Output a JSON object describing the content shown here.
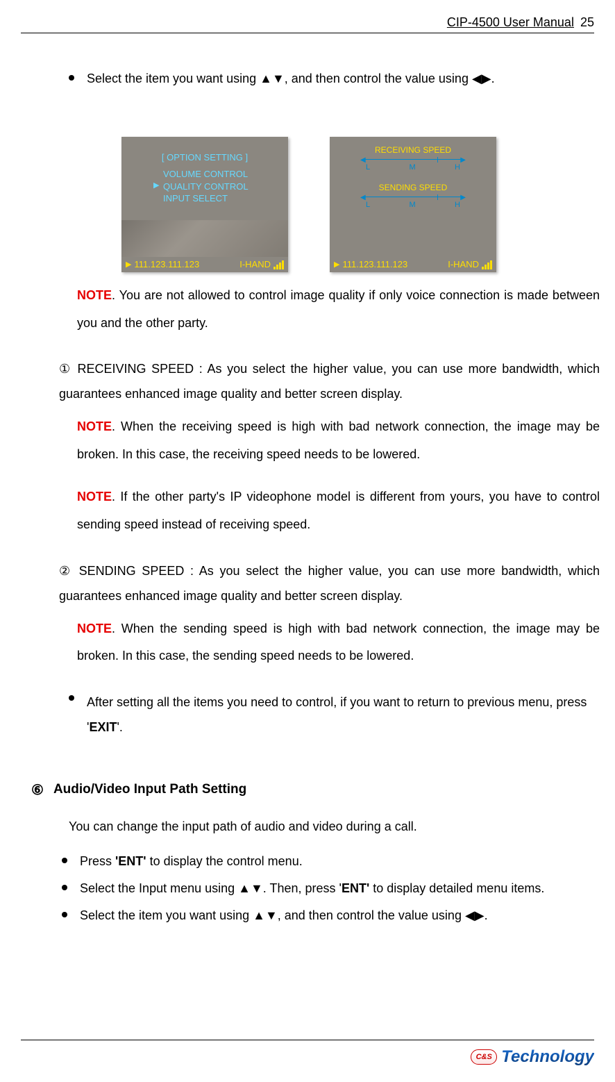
{
  "header": {
    "title": "CIP-4500 User Manual",
    "page": "25"
  },
  "bullets": {
    "top": "Select the item you want using ▲▼, and then control the value using ◀▶."
  },
  "shot1": {
    "title": "[  OPTION SETTING  ]",
    "items": [
      "VOLUME CONTROL",
      "QUALITY CONTROL",
      "INPUT SELECT"
    ],
    "status_ip": "111.123.111.123",
    "status_mode": "I-HAND"
  },
  "shot2": {
    "recv_label": "RECEIVING SPEED",
    "send_label": "SENDING SPEED",
    "ticks": {
      "l": "L",
      "m": "M",
      "h": "H"
    },
    "status_ip": "111.123.111.123",
    "status_mode": "I-HAND"
  },
  "notes": {
    "n1_label": "NOTE",
    "n1_text": ".   You are not allowed to control image quality if only voice connection is made between you and the other party.",
    "p1_num": "①",
    "p1_text": " RECEIVING SPEED : As you select the higher value, you can use more bandwidth, which guarantees enhanced image quality and better screen display.",
    "n2_label": "NOTE",
    "n2_text": ". When the receiving speed is high with bad network connection, the image may be broken. In this case, the receiving speed needs to be lowered.",
    "n3_label": "NOTE",
    "n3_text": ". If the other party's IP videophone model is different from yours, you have to control sending speed instead of receiving speed.",
    "p2_num": "②",
    "p2_text": " SENDING SPEED : As you select the higher value, you can use more bandwidth, which guarantees enhanced image quality and better screen display.",
    "n4_label": "NOTE",
    "n4_text": ". When the sending speed is high with bad network connection, the image may be broken. In this case, the sending speed needs to be lowered.",
    "after_pre": "After setting all the items you need to control, if you want to return to previous menu, press '",
    "after_bold": "EXIT",
    "after_post": "'."
  },
  "section": {
    "num": "⑥",
    "title": "Audio/Video Input Path Setting",
    "intro": "You can change the input path of audio and video during a call.",
    "b1_pre": "Press ",
    "b1_bold": "'ENT'",
    "b1_post": " to display the control menu.",
    "b2_pre": "Select the Input menu using ▲▼. Then, press '",
    "b2_bold": "ENT'",
    "b2_post": " to display detailed menu items.",
    "b3": "Select the item you want using ▲▼, and then control the value using ◀▶."
  },
  "logo": {
    "badge": "C&S",
    "text": "Technology"
  }
}
